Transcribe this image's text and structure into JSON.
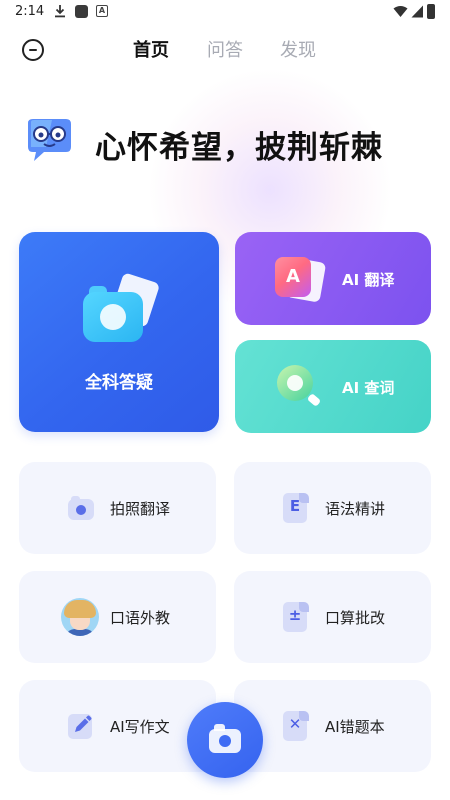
{
  "status_bar": {
    "time": "2:14",
    "notification_icons": [
      "download-icon",
      "square-app-icon",
      "a-app-icon"
    ],
    "system_icons": [
      "wifi-icon",
      "signal-icon",
      "battery-icon"
    ]
  },
  "header": {
    "menu_icon": "minus-circle-icon",
    "tabs": [
      {
        "label": "首页",
        "active": true
      },
      {
        "label": "问答",
        "active": false
      },
      {
        "label": "发现",
        "active": false
      }
    ]
  },
  "hero": {
    "mascot_icon": "chat-mascot-icon",
    "slogan": "心怀希望，披荆斩棘"
  },
  "feature_cards": {
    "main": {
      "label": "全科答疑",
      "icon": "camera-icon",
      "color": "#3366ef"
    },
    "translate": {
      "label": "AI 翻译",
      "icon": "translate-a-icon",
      "color": "#8a5af2"
    },
    "lookup": {
      "label": "AI 查词",
      "icon": "magnifier-icon",
      "color": "#4fd8cb"
    }
  },
  "tools": [
    {
      "label": "拍照翻译",
      "icon": "photo-translate-icon"
    },
    {
      "label": "语法精讲",
      "icon": "grammar-doc-icon",
      "glyph": "E"
    },
    {
      "label": "口语外教",
      "icon": "tutor-avatar-icon"
    },
    {
      "label": "口算批改",
      "icon": "math-check-icon",
      "glyph": "±"
    },
    {
      "label": "AI写作文",
      "icon": "pencil-writing-icon"
    },
    {
      "label": "AI错题本",
      "icon": "mistake-book-icon",
      "glyph": "✕"
    }
  ],
  "fab": {
    "icon": "camera-icon"
  },
  "colors": {
    "accent": "#3366ef",
    "card_bg": "#f3f5fd",
    "icon_tint": "#4c5ee4"
  }
}
